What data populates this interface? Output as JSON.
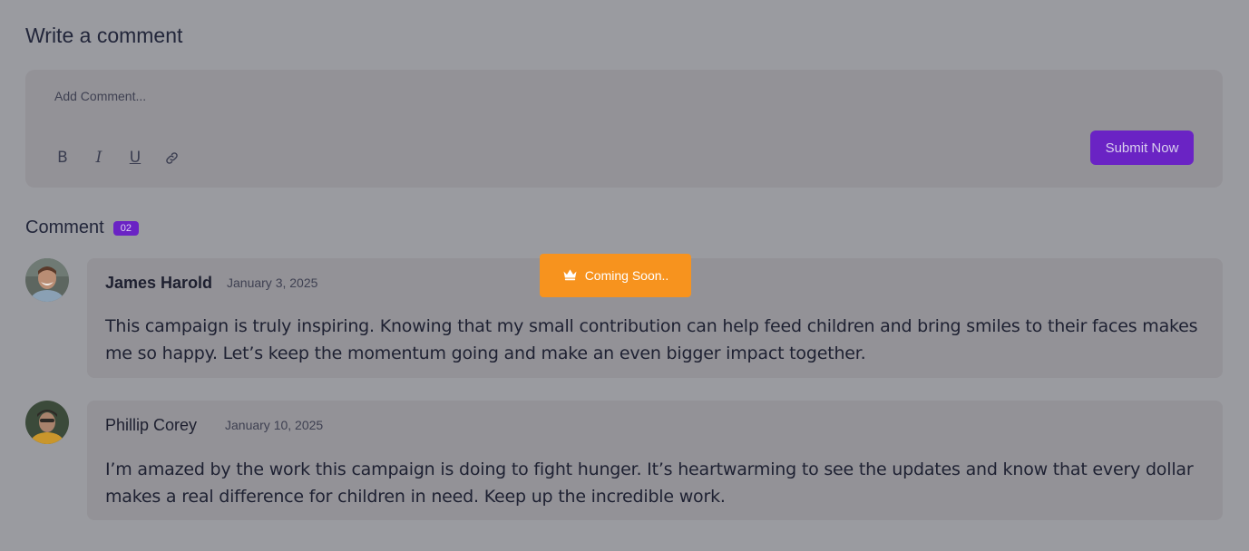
{
  "write": {
    "heading": "Write a comment",
    "placeholder": "Add Comment...",
    "toolbar": {
      "bold": "B",
      "italic": "I",
      "underline": "U"
    },
    "submit_label": "Submit Now"
  },
  "comments": {
    "label": "Comment",
    "count": "02",
    "items": [
      {
        "name": "James Harold",
        "date": "January 3, 2025",
        "text": "This campaign is truly inspiring. Knowing that my small contribution can help feed children and bring smiles to their faces makes me so happy. Let’s keep the momentum going and make an even bigger impact together."
      },
      {
        "name": "Phillip Corey",
        "date": "January 10, 2025",
        "text": "I’m amazed by the work this campaign is doing to fight hunger. It’s heartwarming to see the updates and know that every dollar makes a real difference for children in need. Keep up the incredible work."
      }
    ]
  },
  "toast": {
    "text": "Coming Soon..",
    "icon": "crown-icon",
    "color": "#f7931e"
  },
  "colors": {
    "accent": "#6a23c4",
    "background": "#9a9ba0"
  }
}
